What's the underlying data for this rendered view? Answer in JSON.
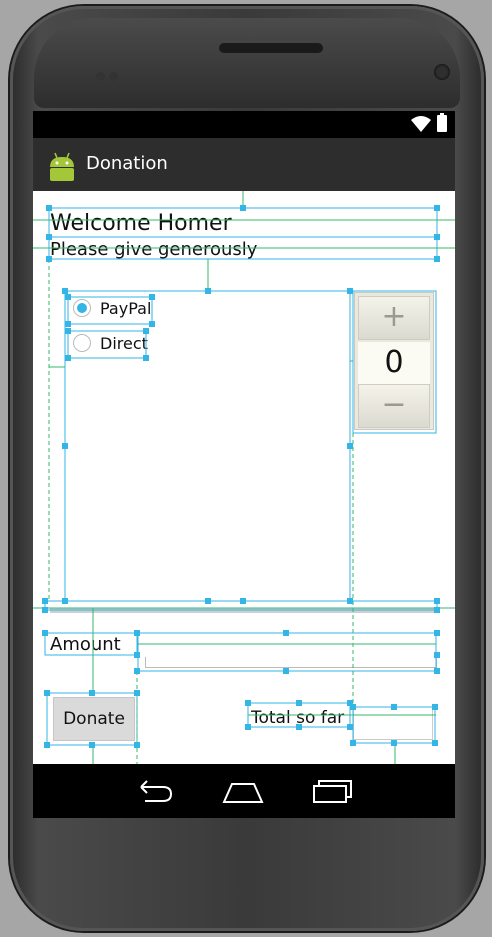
{
  "app": {
    "title": "Donation"
  },
  "header": {
    "welcome": "Welcome Homer",
    "subtitle": "Please give generously"
  },
  "payment_methods": [
    {
      "label": "PayPal",
      "selected": true
    },
    {
      "label": "Direct",
      "selected": false
    }
  ],
  "picker": {
    "increment": "+",
    "value": "0",
    "decrement": "−"
  },
  "form": {
    "amount_label": "Amount",
    "amount_value": "",
    "donate_label": "Donate",
    "total_label": "Total so far",
    "total_value": ""
  },
  "icons": {
    "app": "android-icon",
    "wifi": "wifi-icon",
    "battery": "battery-icon",
    "back": "back-icon",
    "home": "home-icon",
    "recents": "recents-icon"
  },
  "colors": {
    "accent": "#33b5e5",
    "guide": "#33b5e5",
    "constraint": "#36b86b",
    "actionbar": "#2d2d2d"
  }
}
